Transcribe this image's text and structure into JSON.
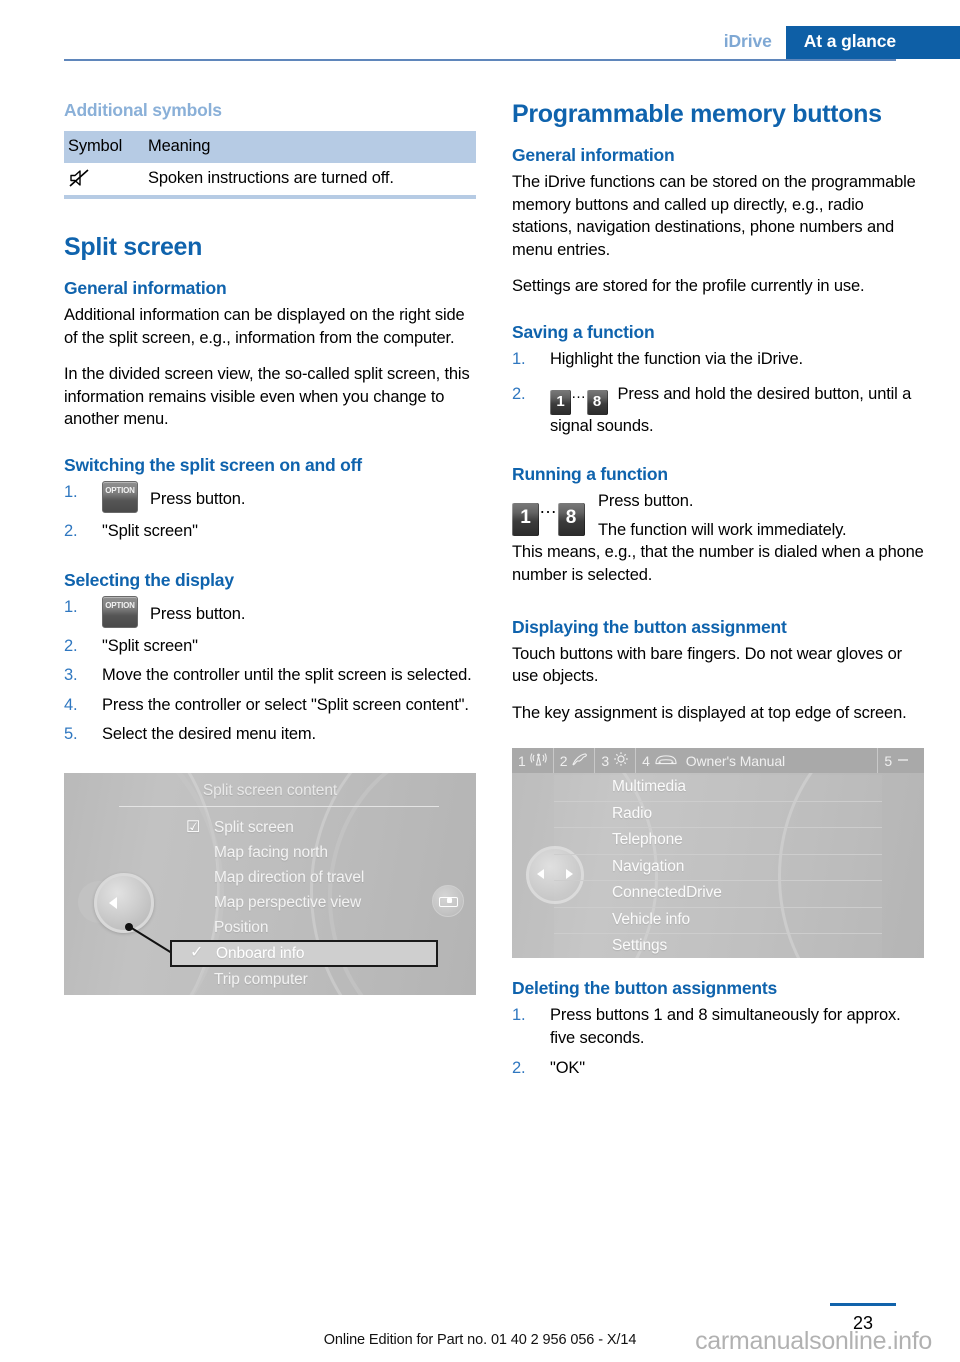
{
  "header": {
    "chapter": "iDrive",
    "section": "At a glance"
  },
  "left_column": {
    "additional_symbols": {
      "heading": "Additional symbols",
      "table": {
        "columns": [
          "Symbol",
          "Meaning"
        ],
        "rows": [
          {
            "symbol_icon": "mute-speaker-icon",
            "meaning": "Spoken instructions are turned off."
          }
        ]
      }
    },
    "split_screen": {
      "title": "Split screen",
      "general_information": {
        "heading": "General information",
        "paragraphs": [
          "Additional information can be displayed on the right side of the split screen, e.g., information from the computer.",
          "In the divided screen view, the so-called split screen, this information remains visible even when you change to another menu."
        ]
      },
      "switching": {
        "heading": "Switching the split screen on and off",
        "steps": [
          {
            "num": "1.",
            "icon": "option-button-icon",
            "icon_label": "OPTION",
            "text": "Press button."
          },
          {
            "num": "2.",
            "text": "\"Split screen\""
          }
        ]
      },
      "selecting": {
        "heading": "Selecting the display",
        "steps": [
          {
            "num": "1.",
            "icon": "option-button-icon",
            "icon_label": "OPTION",
            "text": "Press button."
          },
          {
            "num": "2.",
            "text": "\"Split screen\""
          },
          {
            "num": "3.",
            "text": "Move the controller until the split screen is selected."
          },
          {
            "num": "4.",
            "text": "Press the controller or select \"Split screen content\"."
          },
          {
            "num": "5.",
            "text": "Select the desired menu item."
          }
        ]
      },
      "figure": {
        "title": "Split screen content",
        "items": [
          {
            "label": "Split screen",
            "mark": "checkbox",
            "highlighted": false
          },
          {
            "label": "Map facing north",
            "mark": "none",
            "highlighted": false
          },
          {
            "label": "Map direction of travel",
            "mark": "none",
            "highlighted": false
          },
          {
            "label": "Map perspective view",
            "mark": "none",
            "highlighted": false
          },
          {
            "label": "Position",
            "mark": "none",
            "highlighted": false
          },
          {
            "label": "Onboard info",
            "mark": "check",
            "highlighted": true
          },
          {
            "label": "Trip computer",
            "mark": "none",
            "highlighted": false
          }
        ]
      }
    }
  },
  "right_column": {
    "title": "Programmable memory buttons",
    "general_information": {
      "heading": "General information",
      "paragraphs": [
        "The iDrive functions can be stored on the programmable memory buttons and called up directly, e.g., radio stations, navigation destinations, phone numbers and menu entries.",
        "Settings are stored for the profile currently in use."
      ]
    },
    "saving": {
      "heading": "Saving a function",
      "steps": [
        {
          "num": "1.",
          "text": "Highlight the function via the iDrive."
        },
        {
          "num": "2.",
          "key_from": "1",
          "key_dots": "…",
          "key_to": "8",
          "text": "Press and hold the desired button, until a signal sounds."
        }
      ]
    },
    "running": {
      "heading": "Running a function",
      "key_from": "1",
      "key_dots": "…",
      "key_to": "8",
      "line1": "Press button.",
      "line2": "The function will work immediately.",
      "line3": "This means, e.g., that the number is dialed when a phone number is selected."
    },
    "displaying": {
      "heading": "Displaying the button assignment",
      "paragraphs": [
        "Touch buttons with bare fingers. Do not wear gloves or use objects.",
        "The key assignment is displayed at top edge of screen."
      ],
      "figure": {
        "topbar": [
          {
            "num": "1",
            "icon": "antenna-icon",
            "label": ""
          },
          {
            "num": "2",
            "icon": "phone-icon",
            "label": ""
          },
          {
            "num": "3",
            "icon": "gear-icon",
            "label": ""
          },
          {
            "num": "4",
            "icon": "car-icon",
            "label": "Owner's Manual"
          },
          {
            "num": "5",
            "icon": "dash-icon",
            "label": ""
          }
        ],
        "menu_items": [
          "Multimedia",
          "Radio",
          "Telephone",
          "Navigation",
          "ConnectedDrive",
          "Vehicle info",
          "Settings"
        ]
      }
    },
    "deleting": {
      "heading": "Deleting the button assignments",
      "steps": [
        {
          "num": "1.",
          "text": "Press buttons 1 and 8 simultaneously for approx. five seconds."
        },
        {
          "num": "2.",
          "text": "\"OK\""
        }
      ]
    }
  },
  "footer": {
    "edition": "Online Edition for Part no. 01 40 2 956 056 - X/14",
    "page_number": "23",
    "watermark": "carmanualsonline.info"
  }
}
